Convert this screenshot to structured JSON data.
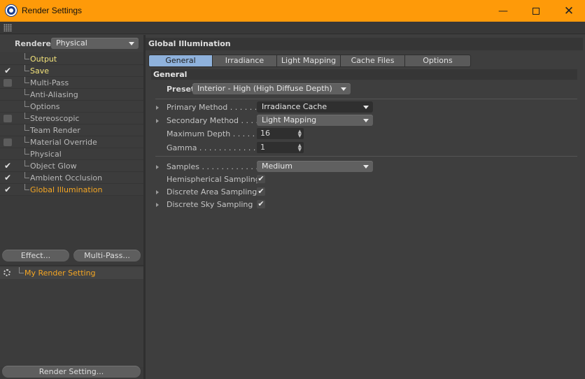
{
  "window": {
    "title": "Render Settings"
  },
  "left": {
    "renderer_label": "Renderer",
    "renderer_value": "Physical",
    "tree": [
      {
        "label": "Output",
        "check": "none",
        "style": "yellow"
      },
      {
        "label": "Save",
        "check": "tick",
        "style": "yellow"
      },
      {
        "label": "Multi-Pass",
        "check": "box",
        "style": "normal"
      },
      {
        "label": "Anti-Aliasing",
        "check": "none",
        "style": "normal"
      },
      {
        "label": "Options",
        "check": "none",
        "style": "normal"
      },
      {
        "label": "Stereoscopic",
        "check": "box",
        "style": "normal"
      },
      {
        "label": "Team Render",
        "check": "none",
        "style": "normal"
      },
      {
        "label": "Material Override",
        "check": "box",
        "style": "normal"
      },
      {
        "label": "Physical",
        "check": "none",
        "style": "normal"
      },
      {
        "label": "Object Glow",
        "check": "tick",
        "style": "normal"
      },
      {
        "label": "Ambient Occlusion",
        "check": "tick",
        "style": "normal"
      },
      {
        "label": "Global Illumination",
        "check": "tick",
        "style": "orange"
      }
    ],
    "effect_button": "Effect...",
    "multipass_button": "Multi-Pass...",
    "setting_name": "My Render Setting",
    "render_setting_button": "Render Setting..."
  },
  "right": {
    "section_title": "Global Illumination",
    "tabs": [
      "General",
      "Irradiance Cache",
      "Light Mapping",
      "Cache Files",
      "Options"
    ],
    "active_tab": "General",
    "group_title": "General",
    "preset_label": "Preset",
    "preset_value": "Interior - High (High Diffuse Depth)",
    "primary_label": "Primary Method . . . . . .",
    "primary_value": "Irradiance Cache",
    "secondary_label": "Secondary Method . . . .",
    "secondary_value": "Light Mapping",
    "maxdepth_label": "Maximum Depth . . . . . .",
    "maxdepth_value": "16",
    "gamma_label": "Gamma . . . . . . . . . . . . .",
    "gamma_value": "1",
    "samples_label": "Samples . . . . . . . . . . . .",
    "samples_value": "Medium",
    "hemi_label": "Hemispherical Sampling",
    "area_label": "Discrete Area Sampling",
    "sky_label": "Discrete Sky Sampling"
  },
  "icons": {
    "check": "check-icon",
    "gear": "gear-icon"
  },
  "colors": {
    "titlebar": "#fe9a09",
    "active_tab": "#8fb2dc",
    "highlight_text": "#f5a623",
    "yellow_text": "#f2e27a"
  }
}
